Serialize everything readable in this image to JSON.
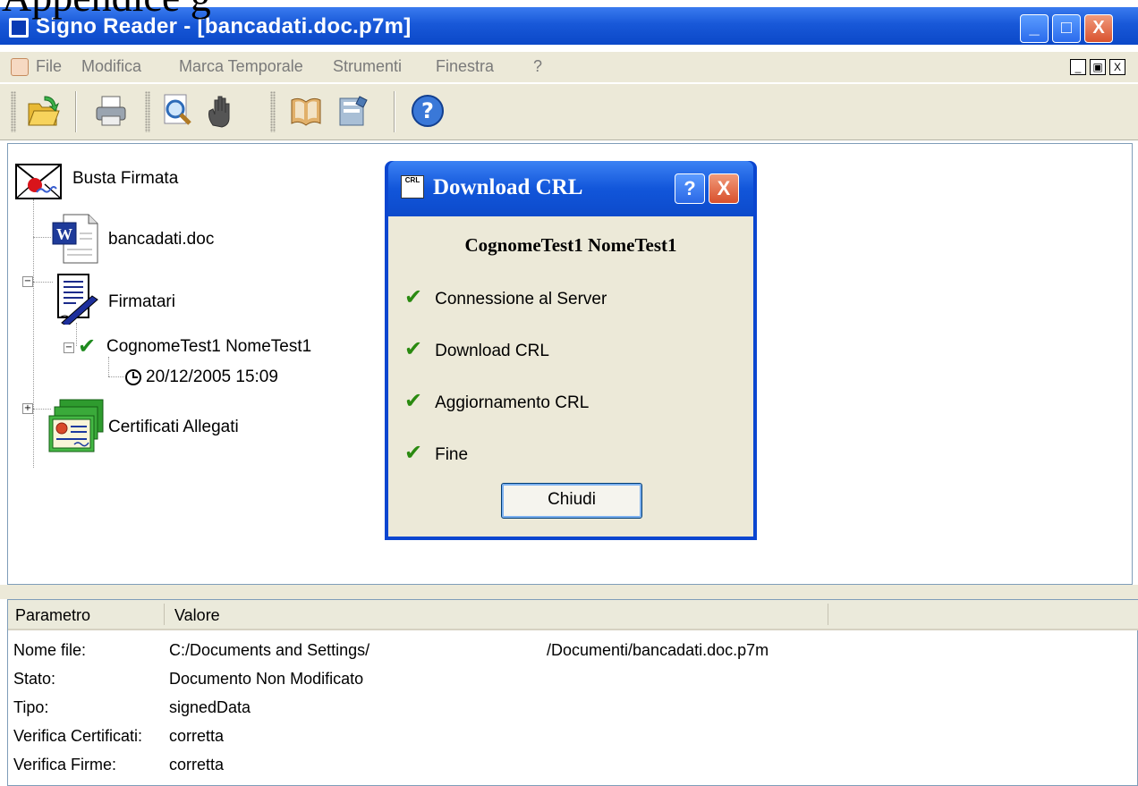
{
  "caption": "Appendice g",
  "window": {
    "title": "Signo Reader - [bancadati.doc.p7m]",
    "controls": {
      "minimize": "_",
      "maximize": "□",
      "close": "X"
    }
  },
  "menu": {
    "items": [
      "File",
      "Modifica",
      "Marca Temporale",
      "Strumenti",
      "Finestra",
      "?"
    ],
    "mdi_controls": [
      "_",
      "▣",
      "X"
    ]
  },
  "toolbar": {
    "buttons": [
      "open-folder-icon",
      "print-icon",
      "search-icon",
      "hand-icon",
      "book-icon",
      "certificate-icon",
      "help-icon"
    ]
  },
  "tree": {
    "root": "Busta Firmata",
    "document": "bancadati.doc",
    "signers_group": "Firmatari",
    "signer": "CognomeTest1 NomeTest1",
    "timestamp": "20/12/2005 15:09",
    "certs_group": "Certificati Allegati",
    "expand_minus": "−",
    "expand_plus": "+"
  },
  "properties": {
    "headers": [
      "Parametro",
      "Valore"
    ],
    "rows": [
      {
        "param": "Nome file:",
        "value": "C:/Documents and Settings/",
        "value2": "/Documenti/bancadati.doc.p7m"
      },
      {
        "param": "Stato:",
        "value": "Documento Non Modificato"
      },
      {
        "param": "Tipo:",
        "value": "signedData"
      },
      {
        "param": "Verifica Certificati:",
        "value": "corretta"
      },
      {
        "param": "Verifica Firme:",
        "value": "corretta"
      }
    ]
  },
  "dialog": {
    "title": "Download CRL",
    "icon_text": "CRL",
    "help": "?",
    "close": "X",
    "name": "CognomeTest1 NomeTest1",
    "steps": [
      "Connessione al Server",
      "Download CRL",
      "Aggiornamento CRL",
      "Fine"
    ],
    "button": "Chiudi"
  },
  "colors": {
    "titlebar": "#1858d8",
    "chrome": "#ece9d8",
    "check_green": "#2a8a10",
    "close_red": "#d9532f"
  }
}
